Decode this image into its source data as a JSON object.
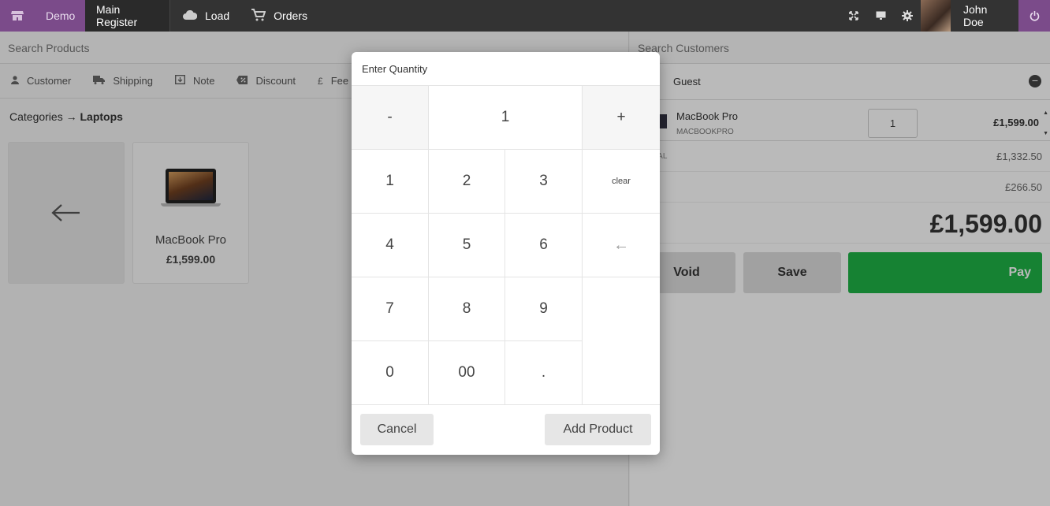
{
  "topbar": {
    "home_icon": "store-icon",
    "store_name": "Demo",
    "register_name": "Main Register",
    "load_label": "Load",
    "orders_label": "Orders",
    "user_name": "John Doe"
  },
  "left": {
    "search_placeholder": "Search Products",
    "actions": [
      {
        "label": "Customer",
        "icon": "user-icon"
      },
      {
        "label": "Shipping",
        "icon": "truck-icon"
      },
      {
        "label": "Note",
        "icon": "note-icon"
      },
      {
        "label": "Discount",
        "icon": "discount-icon"
      },
      {
        "label": "Fee",
        "icon": "pound-icon"
      }
    ],
    "breadcrumb_root": "Categories →",
    "breadcrumb_current": "Laptops",
    "product": {
      "name": "MacBook Pro",
      "price": "£1,599.00"
    }
  },
  "right": {
    "search_placeholder": "Search Customers",
    "customer": "Guest",
    "cart_item": {
      "name": "MacBook Pro",
      "sku": "MACBOOKPRO",
      "qty": "1",
      "price": "£1,599.00"
    },
    "subtotal_label": "OTAL",
    "subtotal_value": "£1,332.50",
    "tax_value": "£266.50",
    "total_label": "AL",
    "total_value": "£1,599.00",
    "void_label": "Void",
    "save_label": "Save",
    "pay_label": "Pay"
  },
  "modal": {
    "title": "Enter Quantity",
    "minus": "-",
    "value": "1",
    "plus": "+",
    "keys": [
      "1",
      "2",
      "3",
      "4",
      "5",
      "6",
      "7",
      "8",
      "9",
      "0",
      "00",
      "."
    ],
    "clear": "clear",
    "backspace": "←",
    "cancel_label": "Cancel",
    "add_label": "Add Product"
  },
  "colors": {
    "accent": "#7b4b8a",
    "pay": "#1fb247",
    "topbar": "#333333"
  }
}
